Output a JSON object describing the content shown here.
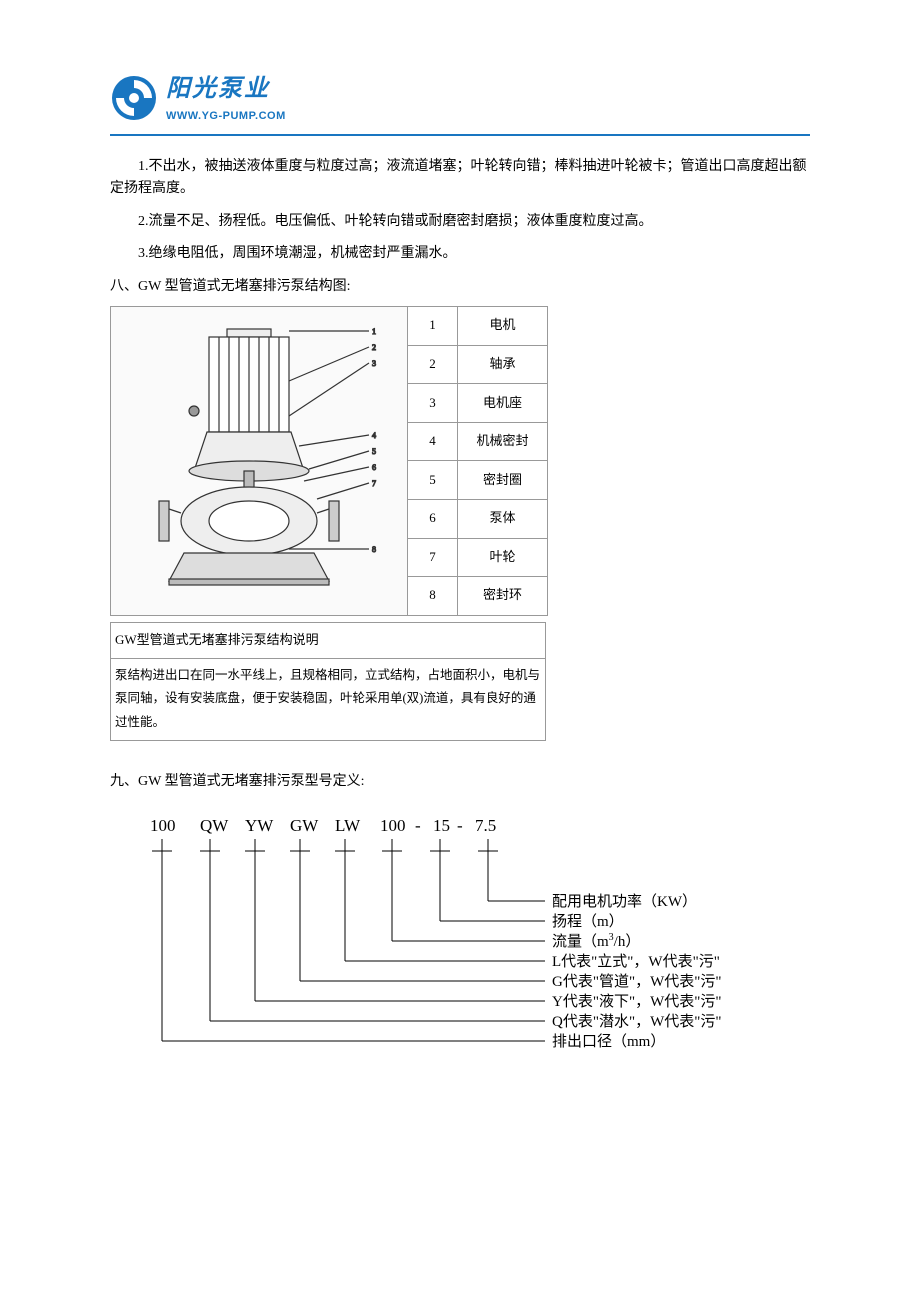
{
  "logo": {
    "cn": "阳光泵业",
    "en": "WWW.YG-PUMP.COM"
  },
  "paras": {
    "p1": "1.不出水，被抽送液体重度与粒度过高；液流道堵塞；叶轮转向错；棒料抽进叶轮被卡；管道出口高度超出额定扬程高度。",
    "p2": "2.流量不足、扬程低。电压偏低、叶轮转向错或耐磨密封磨损；液体重度粒度过高。",
    "p3": "3.绝缘电阻低，周围环境潮湿，机械密封严重漏水。"
  },
  "section8": "八、GW 型管道式无堵塞排污泵结构图:",
  "parts": [
    {
      "n": "1",
      "name": "电机"
    },
    {
      "n": "2",
      "name": "轴承"
    },
    {
      "n": "3",
      "name": "电机座"
    },
    {
      "n": "4",
      "name": "机械密封"
    },
    {
      "n": "5",
      "name": "密封圈"
    },
    {
      "n": "6",
      "name": "泵体"
    },
    {
      "n": "7",
      "name": "叶轮"
    },
    {
      "n": "8",
      "name": "密封环"
    }
  ],
  "desc": {
    "title": "GW型管道式无堵塞排污泵结构说明",
    "body": "泵结构进出口在同一水平线上，且规格相同，立式结构，占地面积小，电机与泵同轴，设有安装底盘，便于安装稳固，叶轮采用单(双)流道，具有良好的通过性能。"
  },
  "section9": "九、GW 型管道式无堵塞排污泵型号定义:",
  "model": {
    "codes": [
      "100",
      "QW",
      "YW",
      "GW",
      "LW",
      "100",
      "-",
      "15",
      "-",
      "7.5"
    ],
    "labels": {
      "power": "配用电机功率（KW）",
      "head": "扬程（m）",
      "flow_pre": "流量（m",
      "flow_sup": "3",
      "flow_post": "/h）",
      "L": "L代表\"立式\"，W代表\"污\"",
      "G": "G代表\"管道\"，W代表\"污\"",
      "Y": "Y代表\"液下\"，W代表\"污\"",
      "Q": "Q代表\"潜水\"，W代表\"污\"",
      "dia": "排出口径（mm）"
    }
  }
}
